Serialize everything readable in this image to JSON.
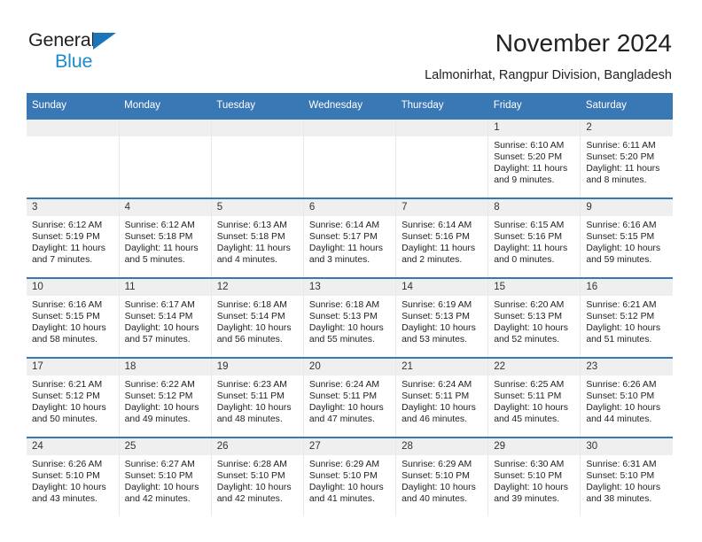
{
  "brand": {
    "name_top": "General",
    "name_bottom": "Blue",
    "triangle_icon": "blue-triangle-icon",
    "color_dark": "#231f20",
    "color_blue": "#1b8bd0"
  },
  "header": {
    "title": "November 2024",
    "subtitle": "Lalmonirhat, Rangpur Division, Bangladesh"
  },
  "theme": {
    "header_blue": "#3a78b5",
    "daynum_bg": "#efefef",
    "cell_bg": "#ffffff",
    "text": "#222222"
  },
  "calendar": {
    "weekday_headers": [
      "Sunday",
      "Monday",
      "Tuesday",
      "Wednesday",
      "Thursday",
      "Friday",
      "Saturday"
    ],
    "weeks": [
      [
        {
          "day": "",
          "lines": []
        },
        {
          "day": "",
          "lines": []
        },
        {
          "day": "",
          "lines": []
        },
        {
          "day": "",
          "lines": []
        },
        {
          "day": "",
          "lines": []
        },
        {
          "day": "1",
          "lines": [
            "Sunrise: 6:10 AM",
            "Sunset: 5:20 PM",
            "Daylight: 11 hours",
            "and 9 minutes."
          ]
        },
        {
          "day": "2",
          "lines": [
            "Sunrise: 6:11 AM",
            "Sunset: 5:20 PM",
            "Daylight: 11 hours",
            "and 8 minutes."
          ]
        }
      ],
      [
        {
          "day": "3",
          "lines": [
            "Sunrise: 6:12 AM",
            "Sunset: 5:19 PM",
            "Daylight: 11 hours",
            "and 7 minutes."
          ]
        },
        {
          "day": "4",
          "lines": [
            "Sunrise: 6:12 AM",
            "Sunset: 5:18 PM",
            "Daylight: 11 hours",
            "and 5 minutes."
          ]
        },
        {
          "day": "5",
          "lines": [
            "Sunrise: 6:13 AM",
            "Sunset: 5:18 PM",
            "Daylight: 11 hours",
            "and 4 minutes."
          ]
        },
        {
          "day": "6",
          "lines": [
            "Sunrise: 6:14 AM",
            "Sunset: 5:17 PM",
            "Daylight: 11 hours",
            "and 3 minutes."
          ]
        },
        {
          "day": "7",
          "lines": [
            "Sunrise: 6:14 AM",
            "Sunset: 5:16 PM",
            "Daylight: 11 hours",
            "and 2 minutes."
          ]
        },
        {
          "day": "8",
          "lines": [
            "Sunrise: 6:15 AM",
            "Sunset: 5:16 PM",
            "Daylight: 11 hours",
            "and 0 minutes."
          ]
        },
        {
          "day": "9",
          "lines": [
            "Sunrise: 6:16 AM",
            "Sunset: 5:15 PM",
            "Daylight: 10 hours",
            "and 59 minutes."
          ]
        }
      ],
      [
        {
          "day": "10",
          "lines": [
            "Sunrise: 6:16 AM",
            "Sunset: 5:15 PM",
            "Daylight: 10 hours",
            "and 58 minutes."
          ]
        },
        {
          "day": "11",
          "lines": [
            "Sunrise: 6:17 AM",
            "Sunset: 5:14 PM",
            "Daylight: 10 hours",
            "and 57 minutes."
          ]
        },
        {
          "day": "12",
          "lines": [
            "Sunrise: 6:18 AM",
            "Sunset: 5:14 PM",
            "Daylight: 10 hours",
            "and 56 minutes."
          ]
        },
        {
          "day": "13",
          "lines": [
            "Sunrise: 6:18 AM",
            "Sunset: 5:13 PM",
            "Daylight: 10 hours",
            "and 55 minutes."
          ]
        },
        {
          "day": "14",
          "lines": [
            "Sunrise: 6:19 AM",
            "Sunset: 5:13 PM",
            "Daylight: 10 hours",
            "and 53 minutes."
          ]
        },
        {
          "day": "15",
          "lines": [
            "Sunrise: 6:20 AM",
            "Sunset: 5:13 PM",
            "Daylight: 10 hours",
            "and 52 minutes."
          ]
        },
        {
          "day": "16",
          "lines": [
            "Sunrise: 6:21 AM",
            "Sunset: 5:12 PM",
            "Daylight: 10 hours",
            "and 51 minutes."
          ]
        }
      ],
      [
        {
          "day": "17",
          "lines": [
            "Sunrise: 6:21 AM",
            "Sunset: 5:12 PM",
            "Daylight: 10 hours",
            "and 50 minutes."
          ]
        },
        {
          "day": "18",
          "lines": [
            "Sunrise: 6:22 AM",
            "Sunset: 5:12 PM",
            "Daylight: 10 hours",
            "and 49 minutes."
          ]
        },
        {
          "day": "19",
          "lines": [
            "Sunrise: 6:23 AM",
            "Sunset: 5:11 PM",
            "Daylight: 10 hours",
            "and 48 minutes."
          ]
        },
        {
          "day": "20",
          "lines": [
            "Sunrise: 6:24 AM",
            "Sunset: 5:11 PM",
            "Daylight: 10 hours",
            "and 47 minutes."
          ]
        },
        {
          "day": "21",
          "lines": [
            "Sunrise: 6:24 AM",
            "Sunset: 5:11 PM",
            "Daylight: 10 hours",
            "and 46 minutes."
          ]
        },
        {
          "day": "22",
          "lines": [
            "Sunrise: 6:25 AM",
            "Sunset: 5:11 PM",
            "Daylight: 10 hours",
            "and 45 minutes."
          ]
        },
        {
          "day": "23",
          "lines": [
            "Sunrise: 6:26 AM",
            "Sunset: 5:10 PM",
            "Daylight: 10 hours",
            "and 44 minutes."
          ]
        }
      ],
      [
        {
          "day": "24",
          "lines": [
            "Sunrise: 6:26 AM",
            "Sunset: 5:10 PM",
            "Daylight: 10 hours",
            "and 43 minutes."
          ]
        },
        {
          "day": "25",
          "lines": [
            "Sunrise: 6:27 AM",
            "Sunset: 5:10 PM",
            "Daylight: 10 hours",
            "and 42 minutes."
          ]
        },
        {
          "day": "26",
          "lines": [
            "Sunrise: 6:28 AM",
            "Sunset: 5:10 PM",
            "Daylight: 10 hours",
            "and 42 minutes."
          ]
        },
        {
          "day": "27",
          "lines": [
            "Sunrise: 6:29 AM",
            "Sunset: 5:10 PM",
            "Daylight: 10 hours",
            "and 41 minutes."
          ]
        },
        {
          "day": "28",
          "lines": [
            "Sunrise: 6:29 AM",
            "Sunset: 5:10 PM",
            "Daylight: 10 hours",
            "and 40 minutes."
          ]
        },
        {
          "day": "29",
          "lines": [
            "Sunrise: 6:30 AM",
            "Sunset: 5:10 PM",
            "Daylight: 10 hours",
            "and 39 minutes."
          ]
        },
        {
          "day": "30",
          "lines": [
            "Sunrise: 6:31 AM",
            "Sunset: 5:10 PM",
            "Daylight: 10 hours",
            "and 38 minutes."
          ]
        }
      ]
    ]
  }
}
